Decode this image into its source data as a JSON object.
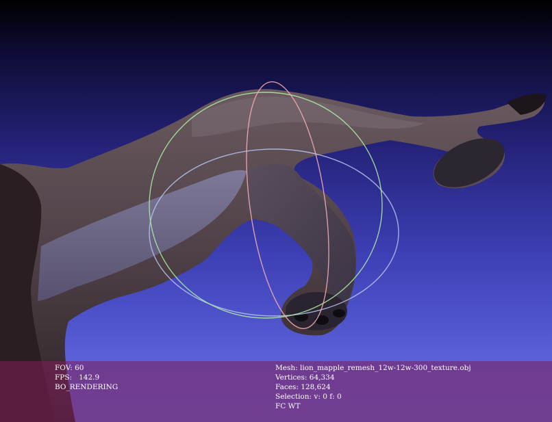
{
  "viewer": {
    "background_top": "#000000",
    "background_bottom": "#6068d8",
    "trackball_colors": {
      "horizontal": "#b8c6f0",
      "vertical_front": "#f0a8b0",
      "vertical_side": "#a8e8a0"
    },
    "info_panel_color": "#8a2a6a"
  },
  "stats": {
    "fov_label": "FOV:",
    "fov_value": "60",
    "fps_label": "FPS:",
    "fps_value": "142.9",
    "rendering_mode": "BO_RENDERING"
  },
  "mesh_info": {
    "mesh_label": "Mesh:",
    "mesh_name": "lion_mapple_remesh_12w-12w-300_texture.obj",
    "vertices_label": "Vertices:",
    "vertices_value": "64,334",
    "faces_label": "Faces:",
    "faces_value": "128,624",
    "selection_label": "Selection:",
    "selection_value": "v: 0 f: 0",
    "flags": "FC WT"
  }
}
